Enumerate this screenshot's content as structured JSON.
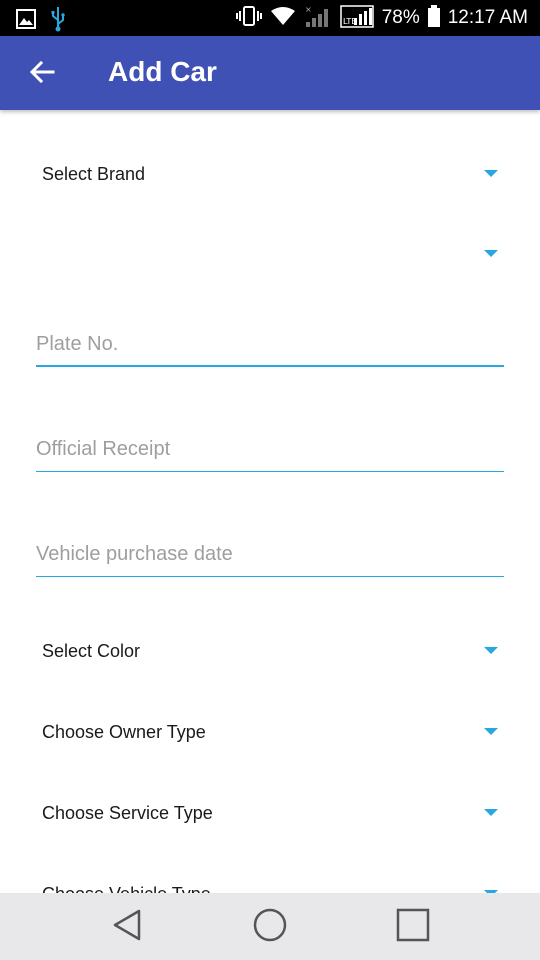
{
  "status_bar": {
    "icons_left": [
      "gallery-icon",
      "usb-icon"
    ],
    "icons_right": [
      "vibrate-icon",
      "wifi-icon",
      "signal-icon",
      "lte-signal-icon",
      "battery-icon"
    ],
    "battery_percent": "78%",
    "time": "12:17 AM"
  },
  "app_bar": {
    "title": "Add Car",
    "color": "#3f51b5",
    "back_icon": "arrow-back-icon"
  },
  "form": {
    "brand_spinner": {
      "label": "Select Brand"
    },
    "model_spinner": {
      "label": ""
    },
    "plate_no": {
      "placeholder": "Plate No.",
      "value": ""
    },
    "official_receipt": {
      "placeholder": "Official Receipt",
      "value": ""
    },
    "purchase_date": {
      "placeholder": "Vehicle purchase date",
      "value": ""
    },
    "color_spinner": {
      "label": "Select Color"
    },
    "owner_type_spinner": {
      "label": "Choose Owner Type"
    },
    "service_type_spinner": {
      "label": "Choose Service Type"
    },
    "vehicle_type_spinner": {
      "label": "Choose Vehicle Type"
    },
    "accent_color": "#29a8e0"
  },
  "nav_bar": {
    "buttons": [
      "back-triangle-icon",
      "home-circle-icon",
      "recents-square-icon"
    ]
  }
}
